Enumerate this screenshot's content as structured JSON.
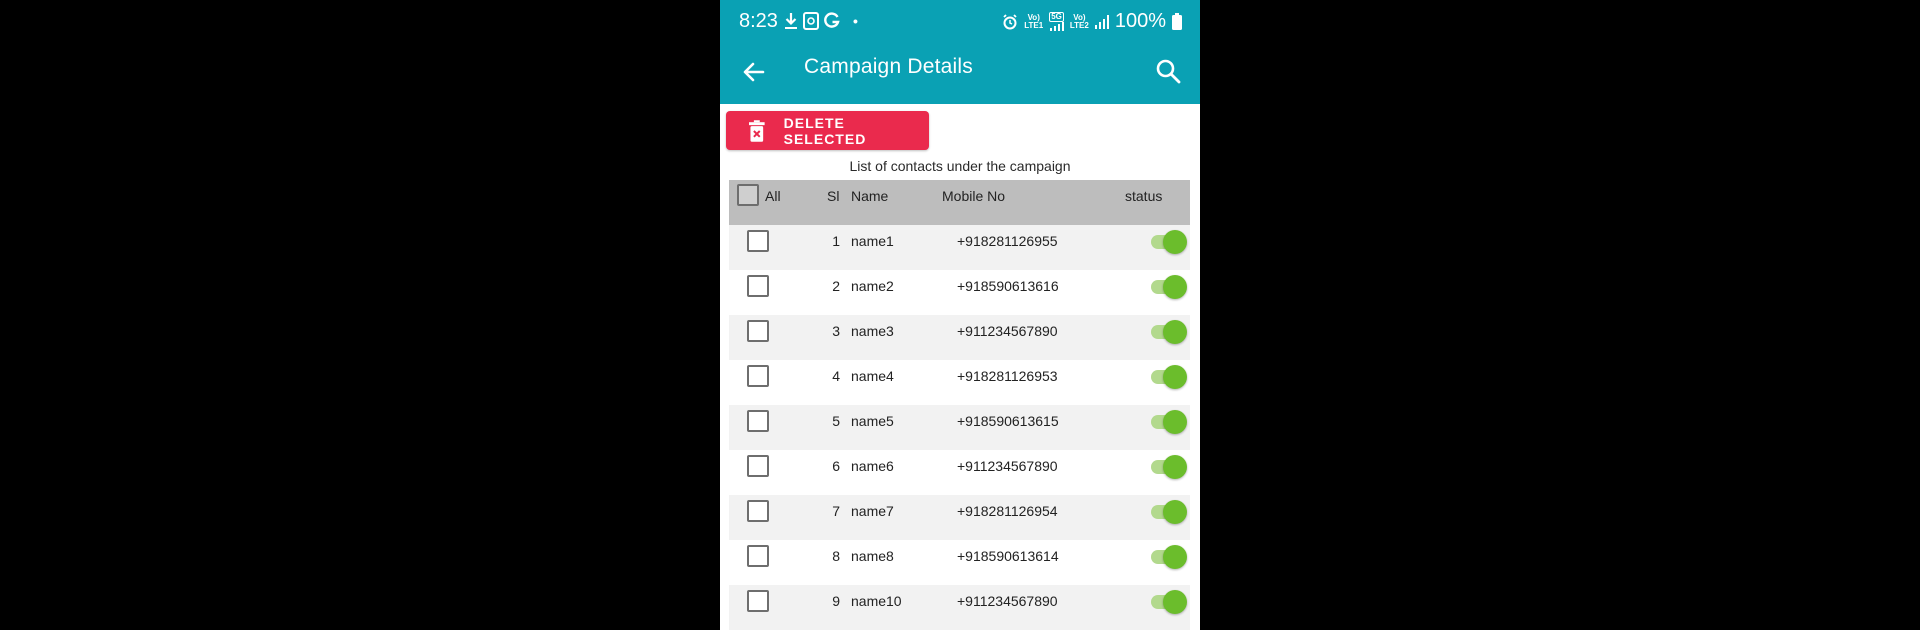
{
  "status_bar": {
    "time": "8:23",
    "left_icons": [
      "download-icon",
      "notification-app-icon",
      "google-icon"
    ],
    "dot": "•",
    "alarm_icon": "alarm-icon",
    "sim1_label_top": "Vo)",
    "sim1_label_bottom": "LTE1",
    "five_g_label": "5G",
    "sim2_label_top": "Vo)",
    "sim2_label_bottom": "LTE2",
    "battery": "100%"
  },
  "app_bar": {
    "title": "Campaign Details",
    "back_icon": "back-arrow-icon",
    "search_icon": "search-icon",
    "color": "#0aa1b4"
  },
  "actions": {
    "delete_label": "DELETE SELECTED",
    "delete_color": "#ea2a4d"
  },
  "subtitle": "List of contacts under the campaign",
  "table": {
    "headers": {
      "all": "All",
      "sl": "Sl",
      "name": "Name",
      "mobile": "Mobile No",
      "status": "status"
    },
    "rows": [
      {
        "sl": "1",
        "name": "name1",
        "mobile": "+918281126955",
        "status": true
      },
      {
        "sl": "2",
        "name": "name2",
        "mobile": "+918590613616",
        "status": true
      },
      {
        "sl": "3",
        "name": "name3",
        "mobile": "+911234567890",
        "status": true
      },
      {
        "sl": "4",
        "name": "name4",
        "mobile": "+918281126953",
        "status": true
      },
      {
        "sl": "5",
        "name": "name5",
        "mobile": "+918590613615",
        "status": true
      },
      {
        "sl": "6",
        "name": "name6",
        "mobile": "+911234567890",
        "status": true
      },
      {
        "sl": "7",
        "name": "name7",
        "mobile": "+918281126954",
        "status": true
      },
      {
        "sl": "8",
        "name": "name8",
        "mobile": "+918590613614",
        "status": true
      },
      {
        "sl": "9",
        "name": "name10",
        "mobile": "+911234567890",
        "status": true
      }
    ],
    "toggle_on_color": "#6bbd2c"
  }
}
